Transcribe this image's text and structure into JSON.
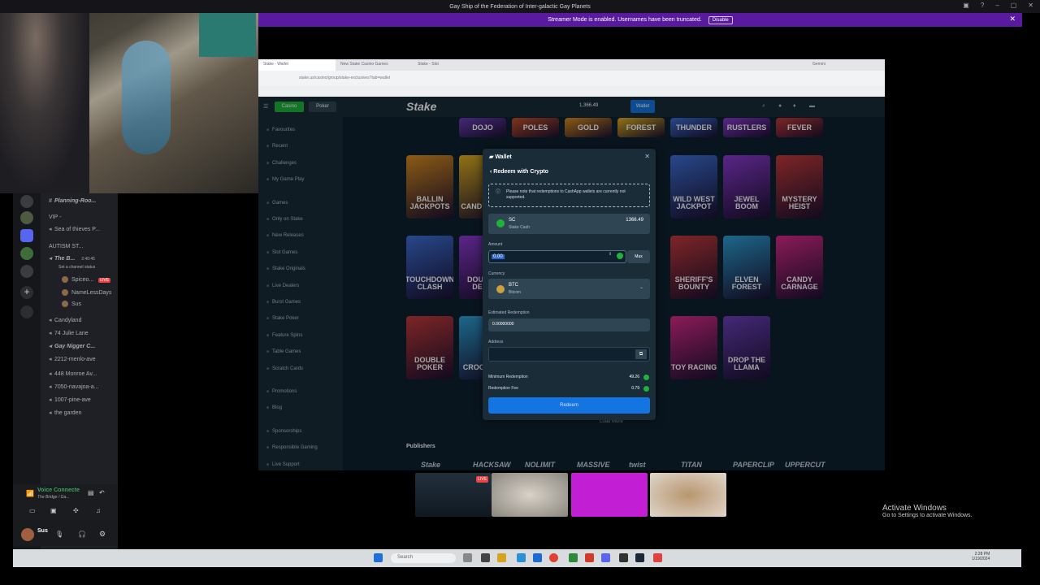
{
  "title_bar": {
    "title": "Gay Ship of the Federation of Inter-galactic Gay Planets"
  },
  "streamer_banner": {
    "text": "Streamer Mode is enabled. Usernames have been truncated.",
    "disable_label": "Disable"
  },
  "discord": {
    "channels": [
      {
        "label": "Planning-Roo...",
        "icon": "hash-icon",
        "style": "italic"
      },
      {
        "label": "VIP -",
        "icon": "none",
        "style": "normal"
      },
      {
        "label": "Sea of thieves P...",
        "icon": "speaker-icon",
        "style": "normal"
      },
      {
        "label": "AUTISM ST...",
        "icon": "none",
        "style": "normal"
      },
      {
        "label": "The B...",
        "icon": "speaker-icon",
        "style": "italic"
      },
      {
        "label": "Set a channel status",
        "icon": "none",
        "style": "normal"
      },
      {
        "label": "Spiceo...",
        "icon": "avatar",
        "style": "normal"
      },
      {
        "label": "NameLessDays",
        "icon": "avatar",
        "style": "normal"
      },
      {
        "label": "Sus",
        "icon": "avatar",
        "style": "normal"
      },
      {
        "label": "Candyland",
        "icon": "speaker-icon",
        "style": "normal"
      },
      {
        "label": "74 Julie Lane",
        "icon": "speaker-icon",
        "style": "normal"
      },
      {
        "label": "Gay Nigger C...",
        "icon": "speaker-icon",
        "style": "italic"
      },
      {
        "label": "2212-menlo-ave",
        "icon": "speaker-icon",
        "style": "normal"
      },
      {
        "label": "448 Monroe Av...",
        "icon": "speaker-icon",
        "style": "normal"
      },
      {
        "label": "7050-navajoa-a...",
        "icon": "speaker-icon",
        "style": "normal"
      },
      {
        "label": "1007-pine-ave",
        "icon": "speaker-icon",
        "style": "normal"
      },
      {
        "label": "the garden",
        "icon": "speaker-icon",
        "style": "normal"
      }
    ],
    "live_badge": "LIVE",
    "channel_time": "2:40:45",
    "voice_status": "Voice Connecte",
    "voice_channel": "The Bridge / Ga...",
    "username": "Sus"
  },
  "browser": {
    "tabs": [
      "Stake - Wallet",
      "New Stake Casino Games",
      "Stake - Slot",
      "Gemini"
    ],
    "address": "stake.us/casino/group/stake-exclusives?tab=wallet"
  },
  "stake": {
    "logo": "Stake",
    "balance": "1,366.49",
    "wallet_button": "Wallet",
    "side_tabs": [
      "Casino",
      "Poker"
    ],
    "sidebar": [
      "Favourites",
      "Recent",
      "Challenges",
      "My Game Play",
      "Games",
      "Only on Stake",
      "New Releases",
      "Slot Games",
      "Stake Originals",
      "Live Dealers",
      "Burst Games",
      "Stake Poker",
      "Feature Spins",
      "Table Games",
      "Scratch Cards",
      "Promotions",
      "Blog",
      "Sponsorships",
      "Responsible Gaming",
      "Live Support"
    ],
    "games_row0": [
      "DOJO",
      "POLES",
      "GOLD",
      "FOREST",
      "THUNDER",
      "RUSTLERS",
      "FEVER"
    ],
    "games_row1": [
      "BALLIN JACKPOTS",
      "CANDY POP",
      "WILD WEST JACKPOT",
      "JEWEL BOOM",
      "MYSTERY HEIST"
    ],
    "games_row2": [
      "TOUCHDOWN CLASH",
      "DOUBLE DEAD",
      "SHERIFF'S BOUNTY",
      "ELVEN FOREST",
      "CANDY CARNAGE"
    ],
    "games_row3": [
      "DOUBLE POKER",
      "CROC RUN",
      "TOY RACING",
      "DROP THE LLAMA"
    ],
    "load_more": "Load More",
    "publishers_title": "Publishers",
    "publishers": [
      "Stake",
      "HACKSAW",
      "NOLIMIT",
      "MASSIVE",
      "twist",
      "TITAN",
      "PAPERCLIP",
      "UPPERCUT"
    ]
  },
  "wallet_modal": {
    "title": "Wallet",
    "subtitle": "Redeem with Crypto",
    "notice": "Please note that redemptions to CashApp wallets are currently not supported.",
    "currency_code": "SC",
    "currency_name": "Stake Cash",
    "currency_balance": "1366.49",
    "amount_label": "Amount",
    "amount_value": "0.00",
    "max_label": "Max",
    "currency_label": "Currency",
    "crypto_code": "BTC",
    "crypto_name": "Bitcoin",
    "estimated_label": "Estimated Redemption",
    "estimated_value": "0.00000000",
    "address_label": "Address",
    "address_value": "",
    "min_label": "Minimum Redemption",
    "min_value": "49.26",
    "fee_label": "Redemption Fee",
    "fee_value": "0.79",
    "redeem_label": "Redeem",
    "colors": {
      "sc_green": "#1fb33a",
      "btc_orange": "#f7931a",
      "button_blue": "#1475e1"
    }
  },
  "stream_thumbs": {
    "live": "LIVE"
  },
  "activate_windows": {
    "title": "Activate Windows",
    "subtitle": "Go to Settings to activate Windows."
  },
  "taskbar": {
    "search": "Search",
    "time": "2:28 PM",
    "date": "1/19/2024"
  }
}
